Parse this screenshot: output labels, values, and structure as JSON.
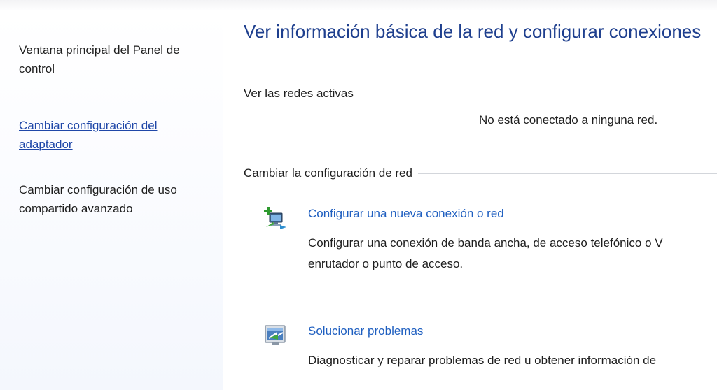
{
  "sidebar": {
    "items": [
      {
        "label": "Ventana principal del Panel de control",
        "line1": "Ventana principal del Panel de",
        "line2": "control"
      },
      {
        "label": "Cambiar configuración del adaptador",
        "line1": "Cambiar configuración del",
        "line2": "adaptador"
      },
      {
        "label": "Cambiar configuración de uso compartido avanzado",
        "line1": "Cambiar configuración de uso",
        "line2": "compartido avanzado"
      }
    ]
  },
  "main": {
    "title": "Ver información básica de la red y configurar conexiones",
    "active_networks": {
      "header": "Ver las redes activas",
      "status": "No está conectado a ninguna red."
    },
    "change_settings": {
      "header": "Cambiar la configuración de red",
      "tasks": [
        {
          "icon": "network-setup-icon",
          "link": "Configurar una nueva conexión o red",
          "desc_line1": "Configurar una conexión de banda ancha, de acceso telefónico o V",
          "desc_line2": "enrutador o punto de acceso."
        },
        {
          "icon": "troubleshoot-icon",
          "link": "Solucionar problemas",
          "desc_line1": "Diagnosticar y reparar problemas de red u obtener información de"
        }
      ]
    }
  },
  "colors": {
    "title": "#1e3f8e",
    "link": "#1f5fc0",
    "nav_link": "#1f47a8",
    "rule": "#d3d6db"
  }
}
